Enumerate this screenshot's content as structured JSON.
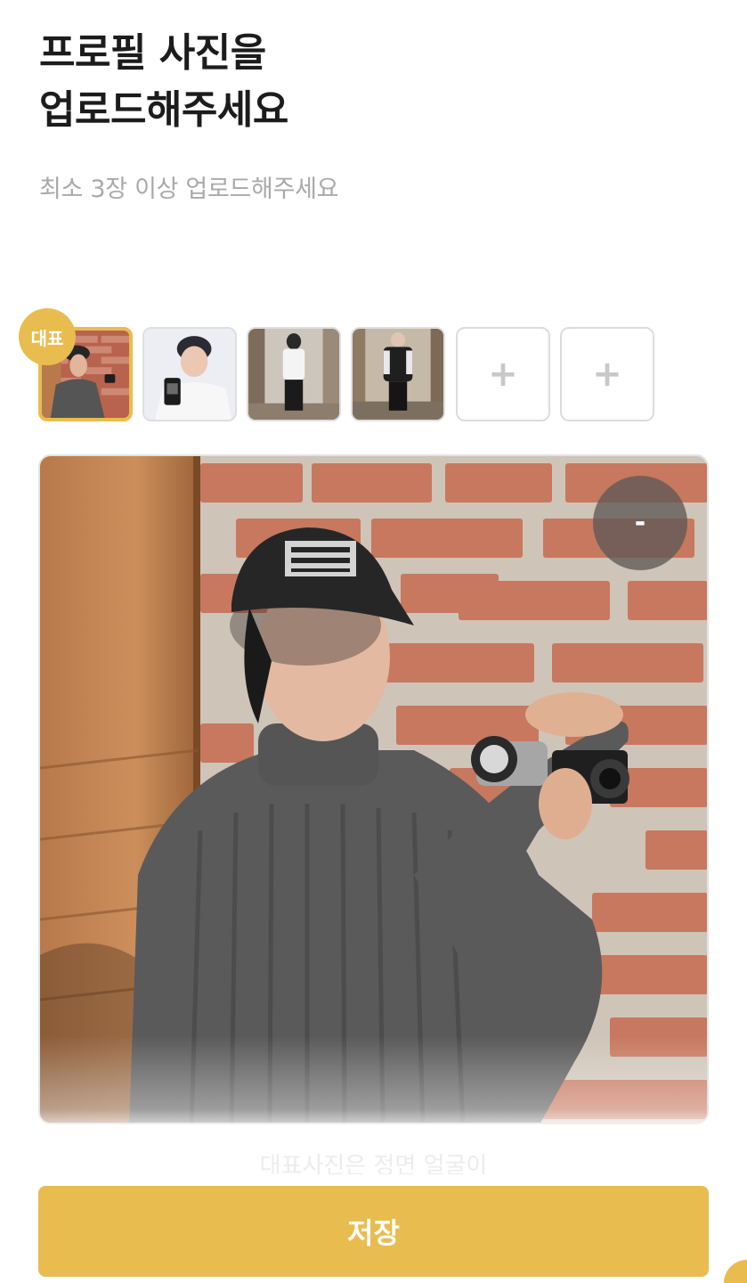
{
  "header": {
    "title_line1": "프로필 사진을",
    "title_line2": "업로드해주세요",
    "subtitle": "최소 3장 이상 업로드해주세요"
  },
  "thumbnails": {
    "badge_label": "대표",
    "items": [
      {
        "type": "photo",
        "selected": true
      },
      {
        "type": "photo",
        "selected": false
      },
      {
        "type": "photo",
        "selected": false
      },
      {
        "type": "photo",
        "selected": false
      },
      {
        "type": "empty",
        "label": "+"
      },
      {
        "type": "empty",
        "label": "+"
      }
    ]
  },
  "preview": {
    "remove_label": "-"
  },
  "hint_text": "대표사진은 정면 얼굴이",
  "save_label": "저장",
  "colors": {
    "accent": "#e9bc4f",
    "subtitle": "#a9a9a9",
    "border": "#dedede"
  }
}
